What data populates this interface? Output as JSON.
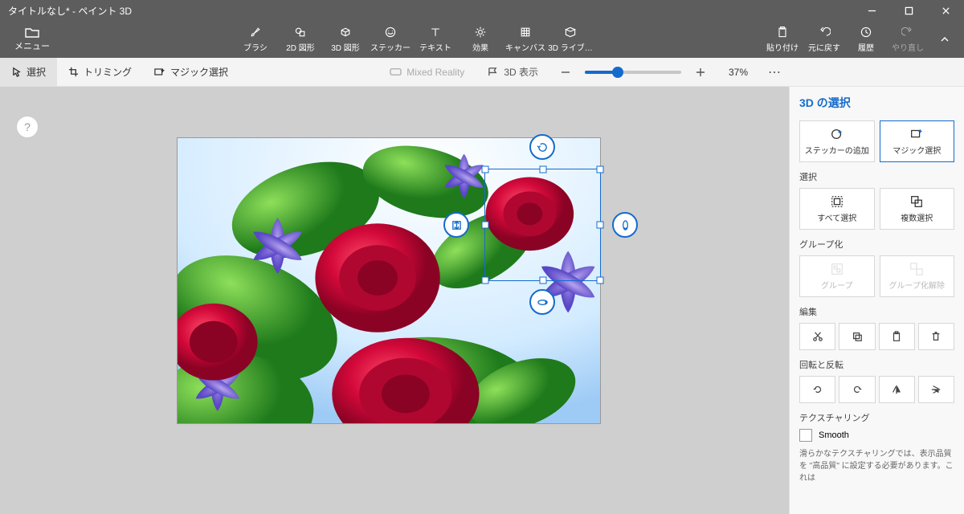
{
  "window": {
    "title": "タイトルなし* - ペイント 3D"
  },
  "ribbon": {
    "menu": "メニュー",
    "tools": [
      {
        "id": "brush",
        "label": "ブラシ"
      },
      {
        "id": "shape2d",
        "label": "2D 図形"
      },
      {
        "id": "shape3d",
        "label": "3D 図形"
      },
      {
        "id": "sticker",
        "label": "ステッカー"
      },
      {
        "id": "text",
        "label": "テキスト"
      },
      {
        "id": "effects",
        "label": "効果"
      },
      {
        "id": "canvas",
        "label": "キャンバス"
      },
      {
        "id": "lib3d",
        "label": "3D ライブ…"
      }
    ],
    "right": [
      {
        "id": "paste",
        "label": "貼り付け"
      },
      {
        "id": "undo",
        "label": "元に戻す"
      },
      {
        "id": "history",
        "label": "履歴"
      },
      {
        "id": "redo",
        "label": "やり直し"
      }
    ]
  },
  "toolbar2": {
    "select": "選択",
    "crop": "トリミング",
    "magic": "マジック選択",
    "mixed_reality": "Mixed Reality",
    "view3d": "3D 表示",
    "zoom": {
      "percent": "37%",
      "value": 37
    }
  },
  "panel": {
    "title": "3D の選択",
    "tiles1": [
      {
        "id": "add-sticker",
        "label": "ステッカーの追加"
      },
      {
        "id": "magic-select",
        "label": "マジック選択"
      }
    ],
    "sec_select_label": "選択",
    "tiles2": [
      {
        "id": "select-all",
        "label": "すべて選択"
      },
      {
        "id": "multi-select",
        "label": "複数選択"
      }
    ],
    "sec_group_label": "グループ化",
    "tiles3": [
      {
        "id": "group",
        "label": "グループ"
      },
      {
        "id": "ungroup",
        "label": "グループ化解除"
      }
    ],
    "sec_edit_label": "編集",
    "sec_rotflip_label": "回転と反転",
    "sec_texture_label": "テクスチャリング",
    "smooth_label": "Smooth",
    "hint": "滑らかなテクスチャリングでは、表示品質を \"高品質\" に設定する必要があります。これは"
  },
  "help": "?"
}
